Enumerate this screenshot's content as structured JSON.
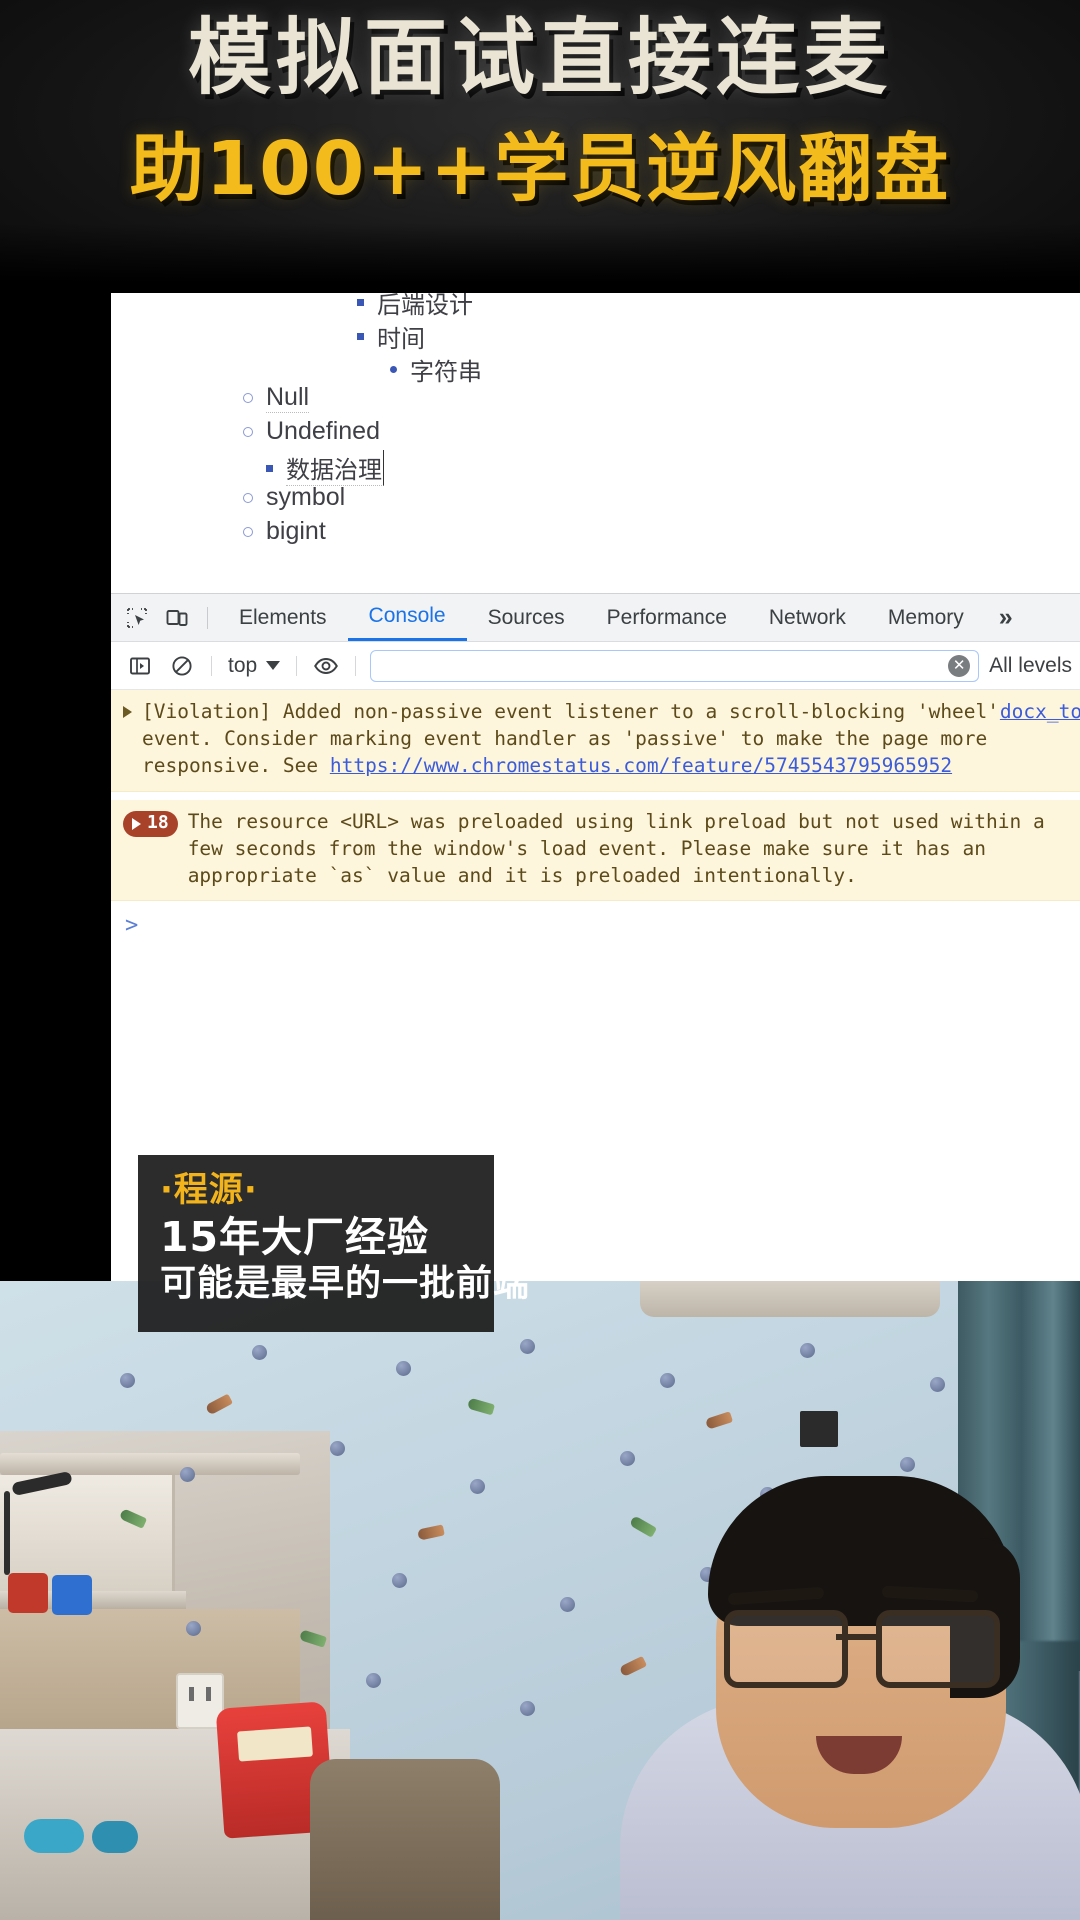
{
  "banner": {
    "line1": "模拟面试直接连麦",
    "line2": "助100++学员逆风翻盘"
  },
  "document": {
    "outline": [
      {
        "label": "后端设计",
        "bullet": "square",
        "indent": 3
      },
      {
        "label": "时间",
        "bullet": "square",
        "indent": 3
      },
      {
        "label": "字符串",
        "bullet": "round",
        "indent": 4
      },
      {
        "label": "Null",
        "bullet": "hollow",
        "indent": 2
      },
      {
        "label": "Undefined",
        "bullet": "hollow",
        "indent": 2
      },
      {
        "label": "数据治理",
        "bullet": "square",
        "indent": 3
      },
      {
        "label": "symbol",
        "bullet": "hollow",
        "indent": 2
      },
      {
        "label": "bigint",
        "bullet": "hollow",
        "indent": 2
      }
    ]
  },
  "devtools": {
    "inspect_icon": "inspect-element-icon",
    "device_icon": "device-toolbar-icon",
    "tabs": [
      {
        "label": "Elements",
        "active": false
      },
      {
        "label": "Console",
        "active": true
      },
      {
        "label": "Sources",
        "active": false
      },
      {
        "label": "Performance",
        "active": false
      },
      {
        "label": "Network",
        "active": false
      },
      {
        "label": "Memory",
        "active": false
      }
    ],
    "more_tabs_label": "»",
    "console_toolbar": {
      "sidebar_icon": "console-sidebar-icon",
      "clear_icon": "clear-console-icon",
      "context": "top",
      "eye_icon": "live-expression-icon",
      "filter_value": "",
      "filter_placeholder": "",
      "clear_filter_icon": "clear-input-icon",
      "levels_label": "All levels"
    },
    "messages": [
      {
        "type": "warning",
        "expand_icon": "expand-triangle-icon",
        "text": "[Violation] Added non-passive event listener to a scroll-blocking 'wheel' event. Consider marking event handler as 'passive' to make the page more responsive. See ",
        "link": "https://www.chromestatus.com/feature/5745543795965952",
        "source": "docx_toolbox_es"
      },
      {
        "type": "warning",
        "count": "18",
        "count_icon": "expand-triangle-icon",
        "text": "The resource <URL> was preloaded using link preload but not used within a few seconds from the window's load event. Please make sure it has an appropriate `as` value and it is preloaded intentionally."
      }
    ],
    "prompt_symbol": ">"
  },
  "caption": {
    "name": "·程源·",
    "line1": "15年大厂经验",
    "line2": "可能是最早的一批前端"
  },
  "colors": {
    "accent_blue": "#1a73e8",
    "banner_gold": "#f3bb1b",
    "warning_bg": "#fdf6dd",
    "badge_red": "#a8432a",
    "link_blue": "#3b5bdb"
  }
}
